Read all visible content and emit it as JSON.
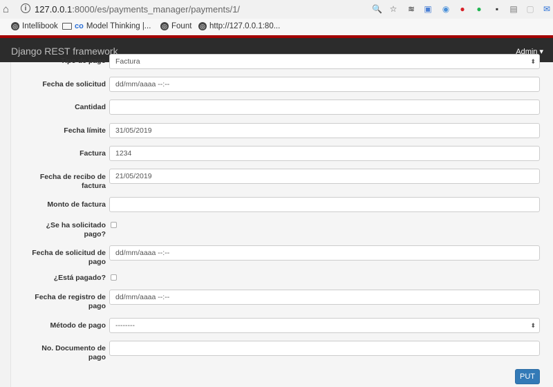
{
  "browser": {
    "url_host": "127.0.0.1",
    "url_path": ":8000/es/payments_manager/payments/1/",
    "bookmarks": [
      "Intellibook",
      "Model Thinking |...",
      "Fount",
      "http://127.0.0.1:80..."
    ]
  },
  "navbar": {
    "brand": "Django REST framework",
    "user": "Admin ▾"
  },
  "form": {
    "partial_field": {
      "label": "Tipo de pago",
      "value": "Factura"
    },
    "fields": [
      {
        "label": "Fecha de solicitud",
        "value": "dd/mm/aaaa --:--"
      },
      {
        "label": "Cantidad",
        "value": ""
      },
      {
        "label": "Fecha límite",
        "value": "31/05/2019"
      },
      {
        "label": "Factura",
        "value": "1234"
      },
      {
        "label": "Fecha de recibo de factura",
        "value": "21/05/2019"
      },
      {
        "label": "Monto de factura",
        "value": ""
      },
      {
        "label": "¿Se ha solicitado pago?",
        "checked": false
      },
      {
        "label": "Fecha de solicitud de pago",
        "value": "dd/mm/aaaa --:--"
      },
      {
        "label": "¿Está pagado?",
        "checked": false
      },
      {
        "label": "Fecha de registro de pago",
        "value": "dd/mm/aaaa --:--"
      },
      {
        "label": "Método de pago",
        "value": "--------"
      },
      {
        "label": "No. Documento de pago",
        "value": ""
      }
    ],
    "submit_label": "PUT"
  },
  "colors": {
    "navbar_bg": "#2c2c2c",
    "navbar_accent": "#a30000",
    "primary_button": "#337ab7"
  }
}
